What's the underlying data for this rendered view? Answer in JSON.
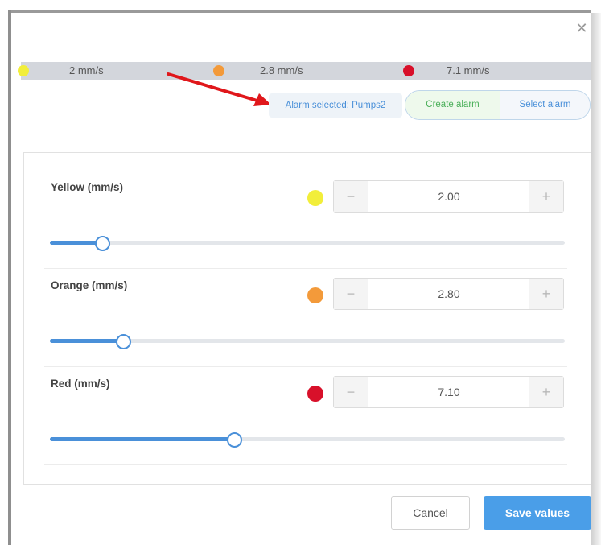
{
  "dialog": {
    "close_icon": "close-icon"
  },
  "levels": [
    {
      "name": "yellow",
      "color": "#f2ee3a",
      "label": "2 mm/s"
    },
    {
      "name": "orange",
      "color": "#f39a3a",
      "label": "2.8 mm/s"
    },
    {
      "name": "red",
      "color": "#d8102a",
      "label": "7.1 mm/s"
    }
  ],
  "alarm": {
    "selected_label": "Alarm selected: Pumps2",
    "create_label": "Create alarm",
    "select_label": "Select alarm"
  },
  "thresholds": [
    {
      "label": "Yellow (mm/s)",
      "color": "#f2ee3a",
      "value": "2.00",
      "slider_fraction": 0.1
    },
    {
      "label": "Orange (mm/s)",
      "color": "#f39a3a",
      "value": "2.80",
      "slider_fraction": 0.14
    },
    {
      "label": "Red (mm/s)",
      "color": "#d8102a",
      "value": "7.10",
      "slider_fraction": 0.357
    }
  ],
  "stepper": {
    "minus_label": "−",
    "plus_label": "+"
  },
  "footer": {
    "cancel_label": "Cancel",
    "save_label": "Save values"
  }
}
